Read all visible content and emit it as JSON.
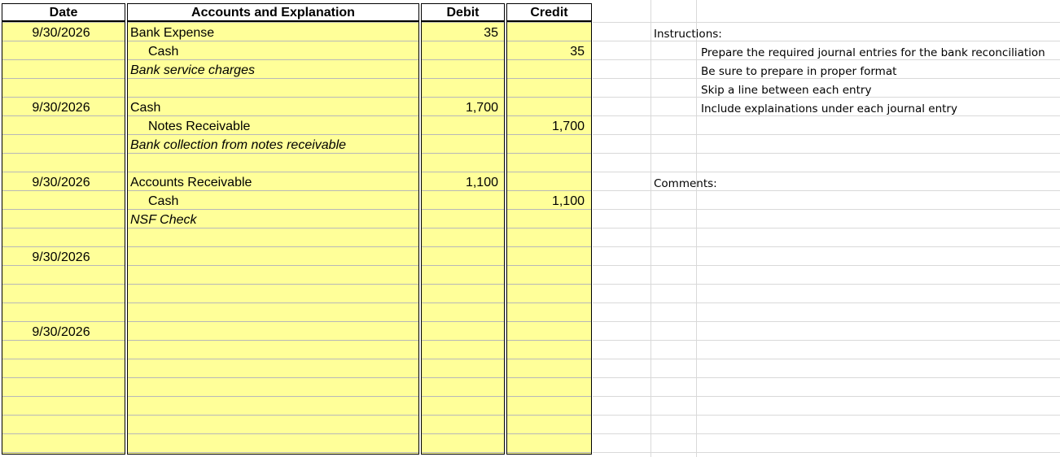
{
  "headers": {
    "date": "Date",
    "accounts": "Accounts and Explanation",
    "debit": "Debit",
    "credit": "Credit"
  },
  "rows": [
    {
      "date": "9/30/2026",
      "account": "Bank Expense",
      "debit": "35",
      "credit": ""
    },
    {
      "date": "",
      "account": "Cash",
      "debit": "",
      "credit": "35"
    },
    {
      "date": "",
      "account": "Bank service charges",
      "debit": "",
      "credit": ""
    },
    {
      "date": "",
      "account": "",
      "debit": "",
      "credit": ""
    },
    {
      "date": "9/30/2026",
      "account": "Cash",
      "debit": "1,700",
      "credit": ""
    },
    {
      "date": "",
      "account": "Notes Receivable",
      "debit": "",
      "credit": "1,700"
    },
    {
      "date": "",
      "account": "Bank collection from notes receivable",
      "debit": "",
      "credit": ""
    },
    {
      "date": "",
      "account": "",
      "debit": "",
      "credit": ""
    },
    {
      "date": "9/30/2026",
      "account": "Accounts Receivable",
      "debit": "1,100",
      "credit": ""
    },
    {
      "date": "",
      "account": "Cash",
      "debit": "",
      "credit": "1,100"
    },
    {
      "date": "",
      "account": "NSF Check",
      "debit": "",
      "credit": ""
    },
    {
      "date": "",
      "account": "",
      "debit": "",
      "credit": ""
    },
    {
      "date": "9/30/2026",
      "account": "",
      "debit": "",
      "credit": ""
    },
    {
      "date": "",
      "account": "",
      "debit": "",
      "credit": ""
    },
    {
      "date": "",
      "account": "",
      "debit": "",
      "credit": ""
    },
    {
      "date": "",
      "account": "",
      "debit": "",
      "credit": ""
    },
    {
      "date": "9/30/2026",
      "account": "",
      "debit": "",
      "credit": ""
    }
  ],
  "instructions": {
    "title": "Instructions:",
    "items": [
      "Prepare the required journal entries for the bank reconciliation",
      "Be sure to prepare in proper format",
      "Skip a line between each entry",
      "Include explainations under each journal entry"
    ]
  },
  "comments": {
    "title": "Comments:"
  }
}
